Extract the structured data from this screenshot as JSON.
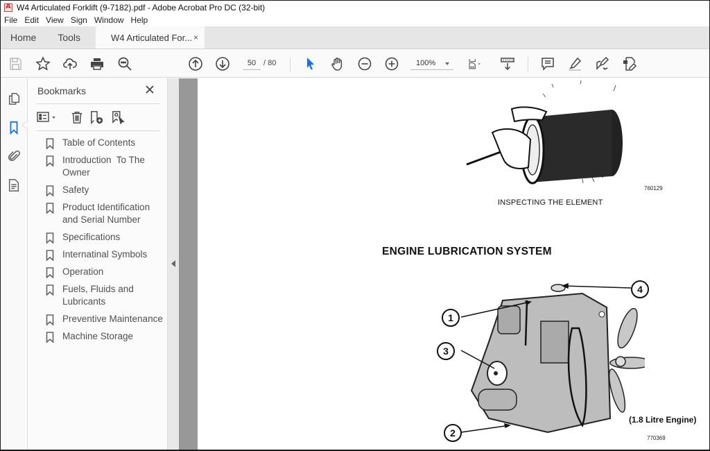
{
  "window": {
    "title": "W4 Articulated Forklift (9-7182).pdf - Adobe Acrobat Pro DC (32-bit)",
    "app_icon": "acrobat-icon"
  },
  "menu": [
    "File",
    "Edit",
    "View",
    "Sign",
    "Window",
    "Help"
  ],
  "tabs": {
    "home": "Home",
    "tools": "Tools",
    "document": "W4 Articulated For...",
    "close_glyph": "×"
  },
  "toolbar": {
    "current_page": "50",
    "total_pages": "/ 80",
    "zoom_level": "100%",
    "icons": [
      "save-icon",
      "bookmark-star-icon",
      "cloud-upload-icon",
      "print-icon",
      "search-icon",
      "page-up-icon",
      "page-down-icon",
      "select-cursor-icon",
      "hand-tool-icon",
      "zoom-out-icon",
      "zoom-in-icon",
      "fit-page-icon",
      "scroll-mode-icon",
      "comment-icon",
      "highlight-icon",
      "sign-icon",
      "edit-pdf-icon"
    ],
    "accent_color": "#1473e6"
  },
  "rail": {
    "icons": [
      "page-thumbnails-icon",
      "bookmarks-icon",
      "attachments-icon",
      "document-properties-icon"
    ],
    "active": "bookmarks-icon"
  },
  "bookmarks": {
    "title": "Bookmarks",
    "close_glyph": "✕",
    "items": [
      "Table of Contents",
      "Introduction  To The\nOwner",
      "Safety",
      "Product Identification\nand Serial Number",
      "Specifications",
      "Internatinal Symbols",
      "Operation",
      "Fuels, Fluids and\nLubricants",
      "Preventive Maintenance",
      "Machine Storage"
    ]
  },
  "document": {
    "figure1_caption": "INSPECTING THE ELEMENT",
    "figure1_number": "760129",
    "section_heading": "ENGINE LUBRICATION SYSTEM",
    "figure2_caption": "(1.8 Litre Engine)",
    "figure2_number": "770369",
    "callouts": [
      "1",
      "2",
      "3",
      "4"
    ]
  }
}
